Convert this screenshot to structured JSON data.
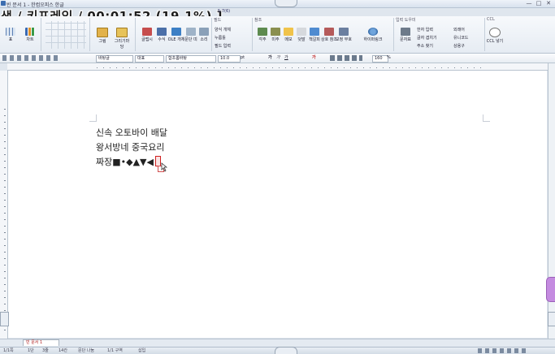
{
  "window": {
    "title": "빈 문서 1 - 한컴오피스 한글",
    "overlay_text": "색 / 키프레임 / 00:01:52 (19.1%) ]",
    "minimize": "—",
    "maximize": "□",
    "close": "✕"
  },
  "ribbon": {
    "quick_label": "5:7(6)",
    "left_tools": [
      "표",
      "차트"
    ],
    "shapes_label": "",
    "insert_buttons": [
      "그림",
      "그리기마당"
    ],
    "obj_buttons": [
      "글맵시",
      "수식",
      "OLE 개체",
      "문단 띠",
      "소리"
    ],
    "field_group": {
      "title": "필드",
      "items": [
        "양식 개체",
        "누름틀",
        "필드 입력"
      ]
    },
    "ref_group": {
      "title": "참조",
      "items": [
        "각주",
        "미주",
        "메모",
        "덧말",
        "책갈피",
        "상호 참조",
        "교정 부호"
      ]
    },
    "hyperlink": "하이퍼링크",
    "input_group": {
      "title": "입력 도우미",
      "items": [
        "문자표",
        "한자 입력",
        "글자 겹치기",
        "주소 찾기",
        "외래어",
        "유니코드",
        "상용구"
      ]
    },
    "ccl_group": {
      "title": "CCL",
      "item": "CCL 넣기"
    }
  },
  "toolbar": {
    "style": "바탕글",
    "lang": "대표",
    "font": "함초롬바탕",
    "size": "10.0",
    "unit": "pt",
    "bold": "가",
    "italic": "가",
    "underline": "가",
    "zoom": "160",
    "zoom_unit": "%"
  },
  "document": {
    "lines": [
      "신속 오토바이 배달",
      "왕서방네 중국요리",
      "짜장■•◆▲▼◀"
    ]
  },
  "tabs": {
    "current": "빈 문서 1"
  },
  "status": {
    "page": "1/1쪽",
    "section": "1단",
    "line": "3줄",
    "col": "14칸",
    "cursor_info": "문단 나눔",
    "mode": "1/1 구역",
    "insert": "삽입"
  }
}
